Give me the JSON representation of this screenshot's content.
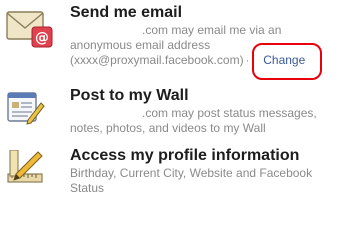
{
  "permissions": [
    {
      "icon": "envelope-icon",
      "title": "Send me email",
      "desc_line1": ".com may email me via an",
      "desc_line2": "anonymous email address",
      "desc_line3": "(xxxx@proxymail.facebook.com)",
      "separator": "·",
      "action": "Change"
    },
    {
      "icon": "wall-post-icon",
      "title": "Post to my Wall",
      "desc_line1": ".com may post status messages,",
      "desc_line2": "notes, photos, and videos to my Wall"
    },
    {
      "icon": "ruler-pencil-icon",
      "title": "Access my profile information",
      "desc_line1": "Birthday, Current City, Website and Facebook",
      "desc_line2": "Status"
    }
  ],
  "colors": {
    "title": "#1d1d1d",
    "description": "#8a8a8a",
    "link": "#3b5998",
    "highlight_circle": "#e8000d"
  }
}
